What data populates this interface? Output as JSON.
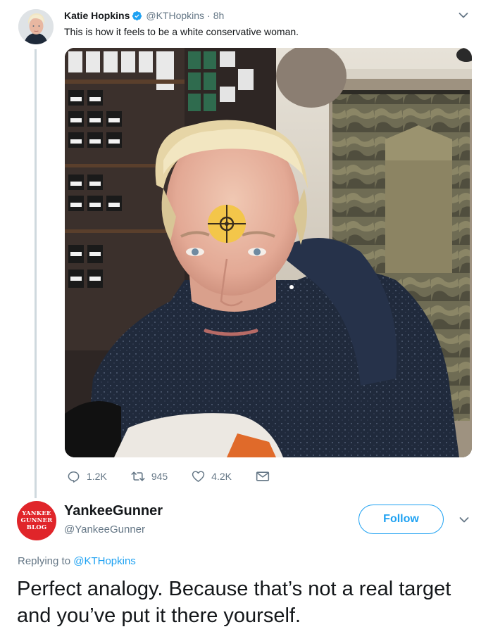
{
  "tweet": {
    "author_name": "Katie Hopkins",
    "author_handle": "@KTHopkins",
    "separator": "·",
    "time": "8h",
    "text": "This is how it feels to be a white conservative woman.",
    "actions": {
      "replies": "1.2K",
      "retweets": "945",
      "likes": "4.2K"
    }
  },
  "reply": {
    "avatar_text": [
      "YANKEE",
      "GUNNER",
      "BLOG"
    ],
    "author_name": "YankeeGunner",
    "author_handle": "@YankeeGunner",
    "follow_label": "Follow",
    "replying_to_prefix": "Replying to",
    "replying_to_handle": "@KTHopkins",
    "text": "Perfect analogy. Because that’s not a real target and you’ve put it there yourself."
  },
  "colors": {
    "accent": "#1da1f2",
    "secondary_text": "#657786",
    "avatar_red": "#e0252a",
    "verified": "#1da1f2"
  },
  "icons": [
    "verified-badge-icon",
    "chevron-down-icon",
    "reply-icon",
    "retweet-icon",
    "like-icon",
    "direct-message-icon"
  ]
}
